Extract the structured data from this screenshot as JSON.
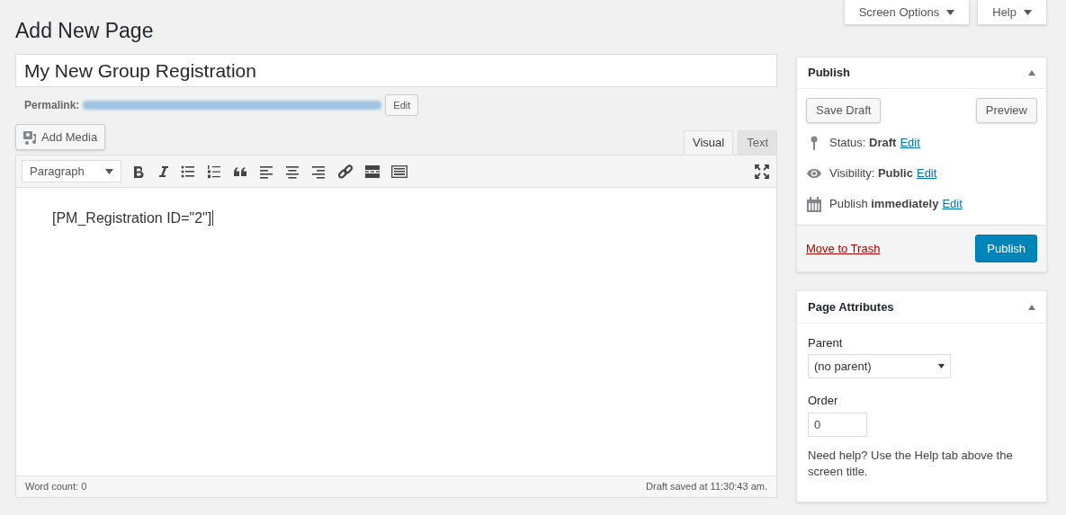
{
  "top_buttons": [
    {
      "label": "Screen Options"
    },
    {
      "label": "Help"
    }
  ],
  "heading": "Add New Page",
  "title_field": {
    "value": "My New Group Registration"
  },
  "permalink": {
    "label": "Permalink:",
    "edit": "Edit"
  },
  "add_media": "Add Media",
  "editor_tabs": [
    {
      "label": "Visual",
      "selected": true
    },
    {
      "label": "Text",
      "selected": false
    }
  ],
  "format_select": "Paragraph",
  "content": "[PM_Registration ID=\"2\"]",
  "status_bar": {
    "word_count": "Word count: 0",
    "saved": "Draft saved at 11:30:43 am."
  },
  "publish_box": {
    "title": "Publish",
    "save_draft": "Save Draft",
    "preview": "Preview",
    "meta": [
      {
        "kind": "status",
        "text": "Status: **Draft**",
        "link": "Edit"
      },
      {
        "kind": "visibility",
        "text": "Visibility: **Public**",
        "link": "Edit"
      },
      {
        "kind": "schedule",
        "text": "Publish **immediately**",
        "link": "Edit"
      }
    ],
    "trash": "Move to Trash",
    "publish": "Publish"
  },
  "attributes_box": {
    "title": "Page Attributes",
    "parent_label": "Parent",
    "parent_value": "(no parent)",
    "order_label": "Order",
    "order_value": "0",
    "help": "Need help? Use the Help tab above the screen title."
  }
}
